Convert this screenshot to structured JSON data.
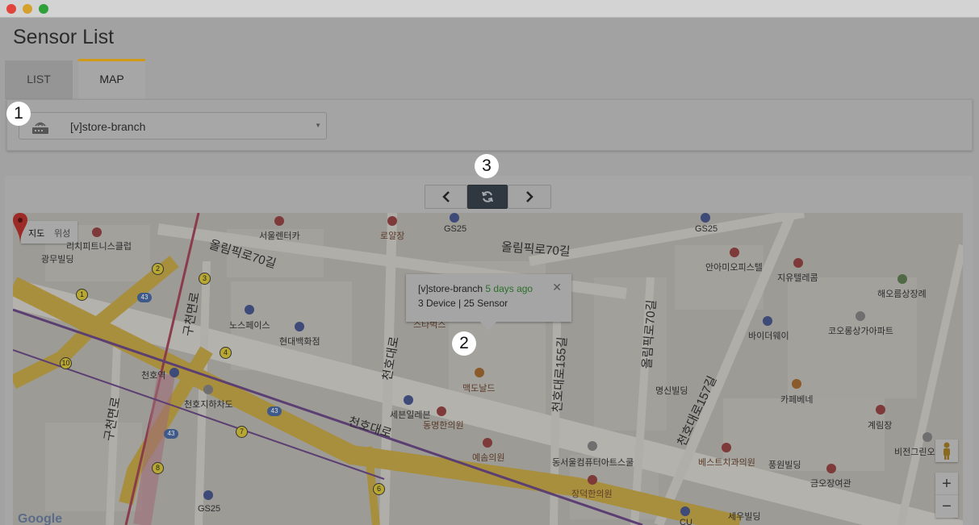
{
  "window": {
    "title": "Sensor List"
  },
  "tabs": [
    {
      "label": "LIST"
    },
    {
      "label": "MAP"
    }
  ],
  "branch_select": {
    "value": "[v]store-branch"
  },
  "callouts": [
    "1",
    "2",
    "3"
  ],
  "nav": {
    "prev_icon": "chevron-left-icon",
    "refresh_icon": "refresh-icon",
    "next_icon": "chevron-right-icon"
  },
  "map": {
    "type_toggle": {
      "map": "지도",
      "satellite": "위성"
    },
    "info_window": {
      "name": "[v]store-branch",
      "ago": "5 days ago",
      "summary": "3 Device | 25 Sensor"
    },
    "marker_label": "맥도날드",
    "roads": [
      "올림픽로70길",
      "올림픽로70길",
      "천호대로",
      "천호대로",
      "천호대로155길",
      "올림픽로70길",
      "천호대로157길",
      "구천면로",
      "구천면로"
    ],
    "places": [
      "서울렌터카",
      "로얄장",
      "GS25",
      "GS25",
      "리치피트니스클럽",
      "광무빌딩",
      "안아미오피스텔",
      "지유텔레콤",
      "해오름상장례",
      "노스페이스",
      "현대백화점",
      "스타벅스",
      "바이더웨이",
      "코오롱상가아파트",
      "천호역",
      "천호지하차도",
      "세븐일레븐",
      "동명한의원",
      "명신빌딩",
      "카페베네",
      "계림장",
      "비전그린오",
      "예솜의원",
      "동서울컴퓨터아트스쿨",
      "베스트치과의원",
      "풍원빌딩",
      "금오장여관",
      "장덕한의원",
      "GS25",
      "세우빌딩",
      "CU"
    ],
    "subway_numbers": [
      "1",
      "2",
      "3",
      "4",
      "6",
      "7",
      "8",
      "10"
    ],
    "route_shields": [
      "43",
      "43",
      "43"
    ],
    "zoom_in": "+",
    "zoom_out": "−",
    "attribution": "Google"
  }
}
